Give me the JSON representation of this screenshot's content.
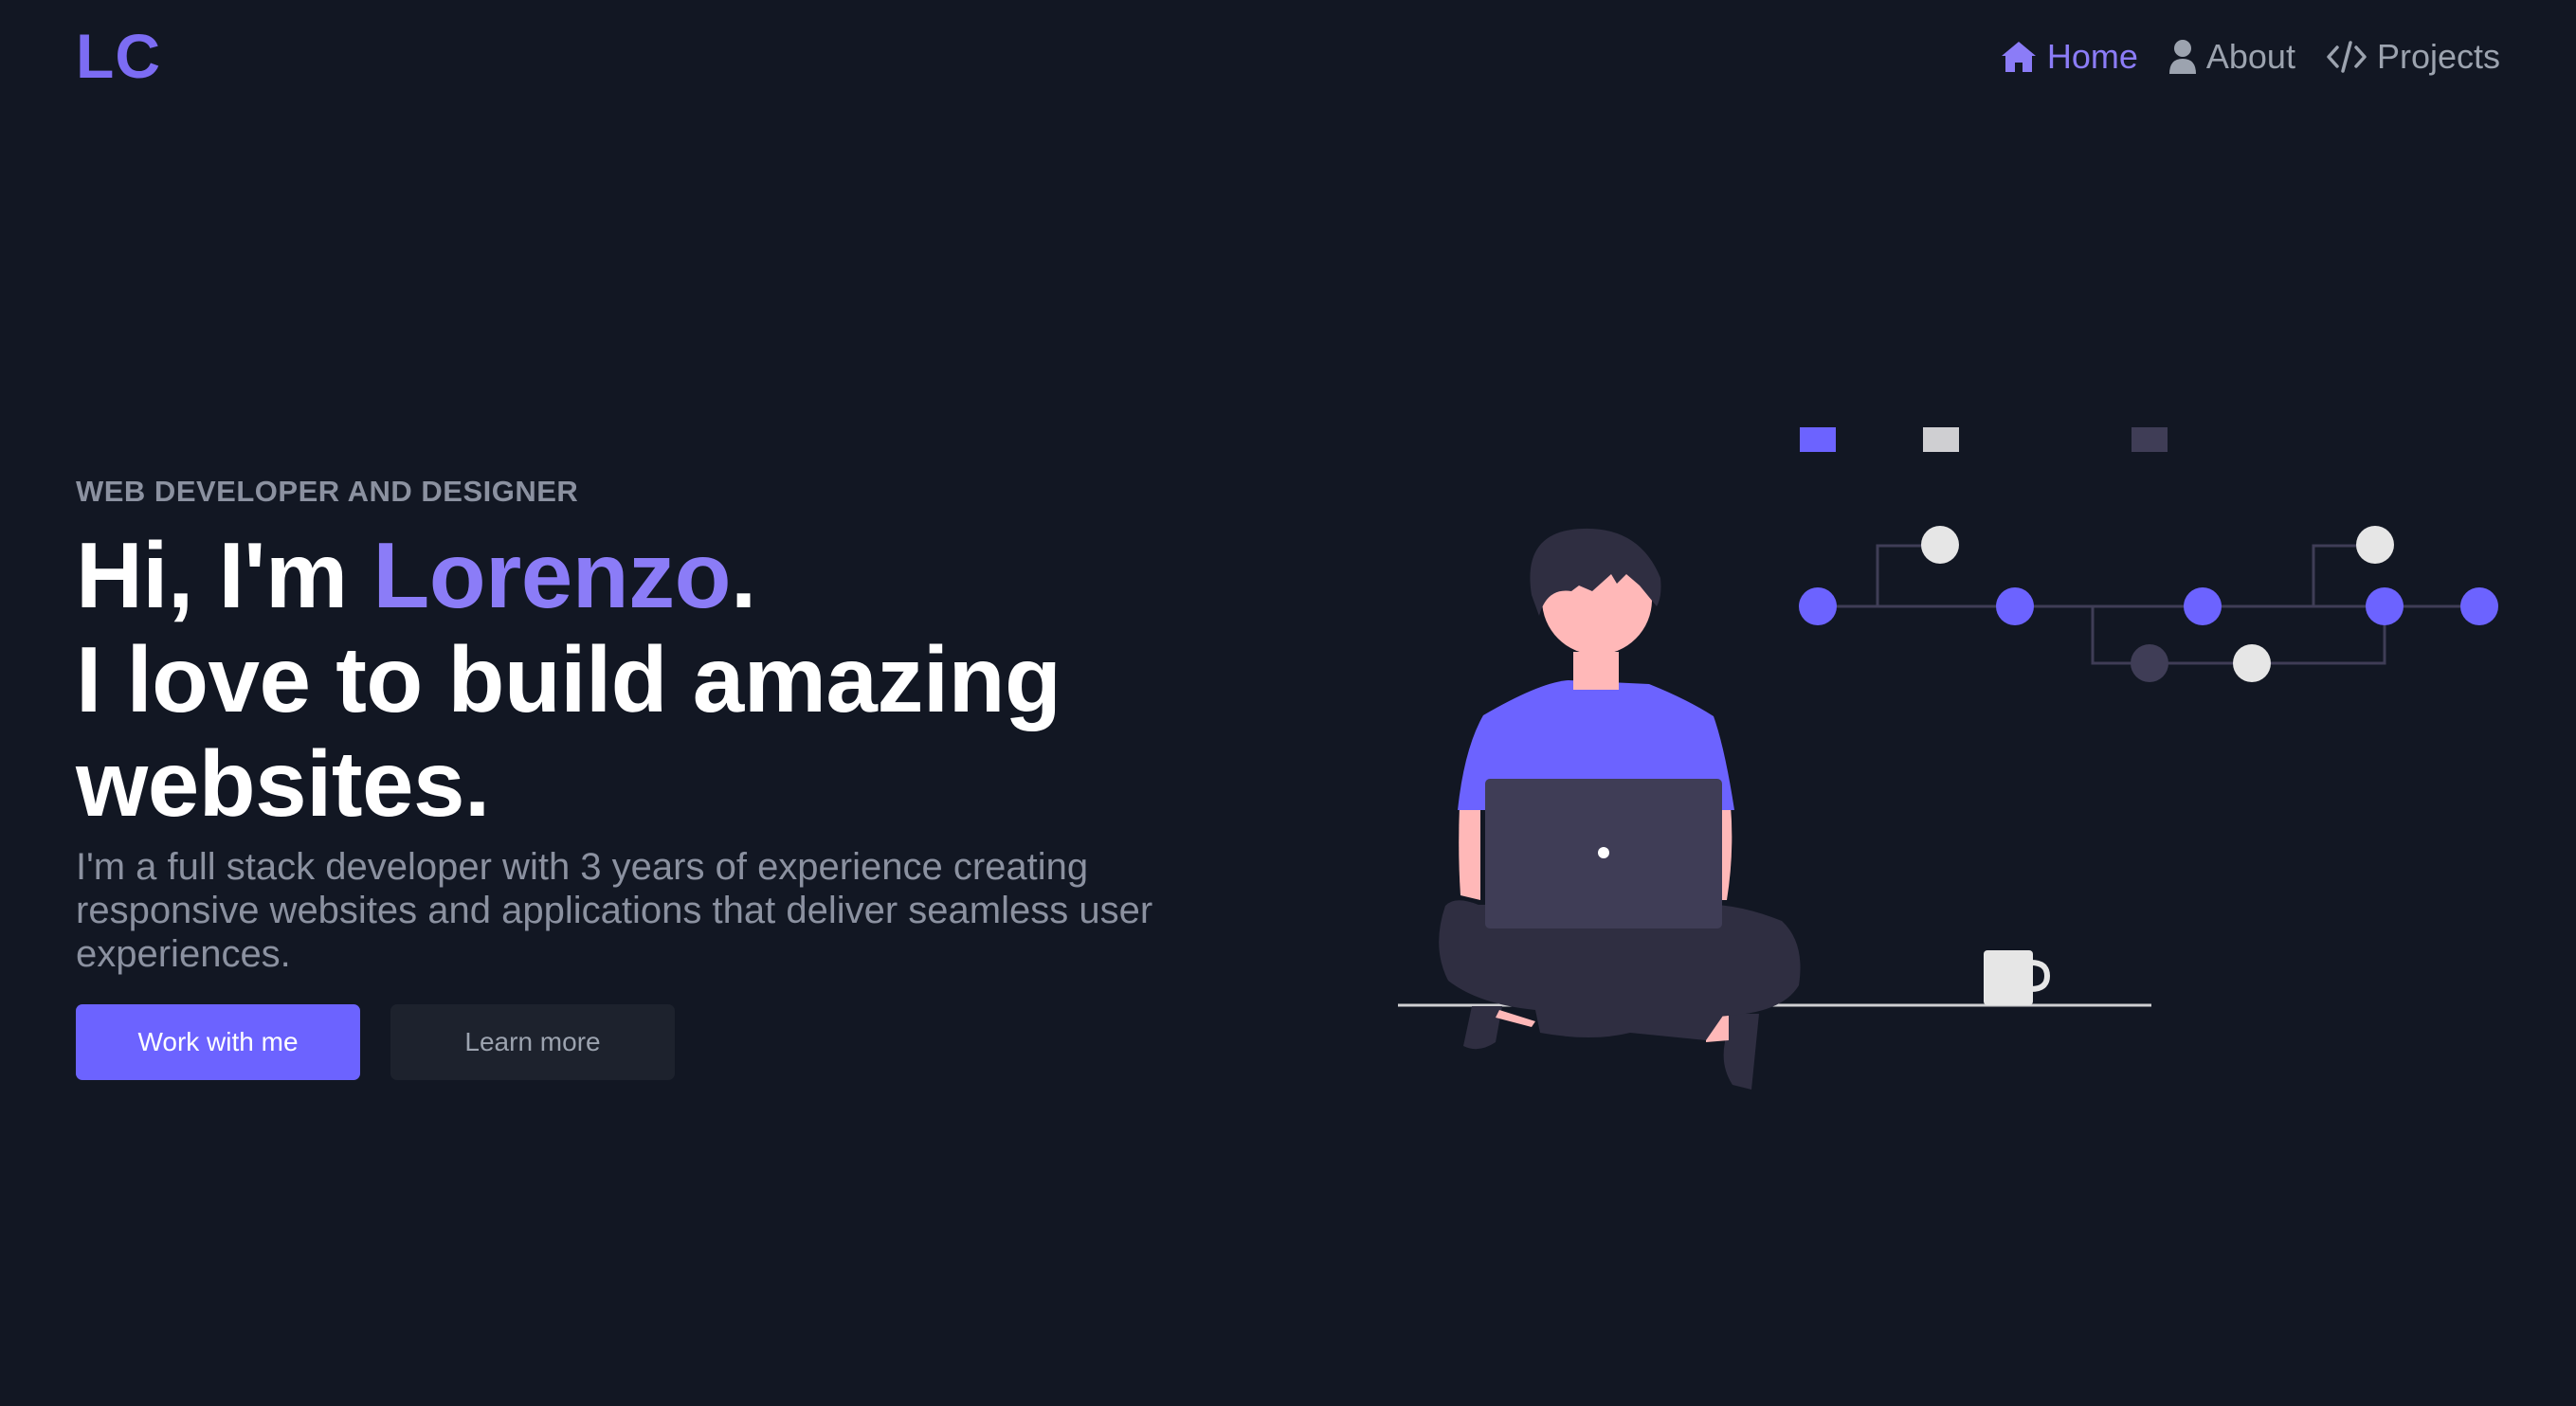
{
  "brand": {
    "logo": "LC",
    "accent": "#8b7cf7",
    "primary": "#6c63ff",
    "background": "#121723"
  },
  "nav": {
    "items": [
      {
        "label": "Home",
        "icon": "home-icon",
        "active": true
      },
      {
        "label": "About",
        "icon": "user-icon",
        "active": false
      },
      {
        "label": "Projects",
        "icon": "code-icon",
        "active": false
      }
    ]
  },
  "hero": {
    "eyebrow": "WEB DEVELOPER AND DESIGNER",
    "greeting_prefix": "Hi, I'm ",
    "name": "Lorenzo",
    "greeting_suffix": ".",
    "headline_line2": "I love to build amazing websites.",
    "description": "I'm a full stack developer with 3 years of experience creating responsive websites and applications that deliver seamless user experiences.",
    "primary_button": "Work with me",
    "secondary_button": "Learn more"
  },
  "illustration": {
    "icon": "developer-with-laptop-illustration"
  }
}
